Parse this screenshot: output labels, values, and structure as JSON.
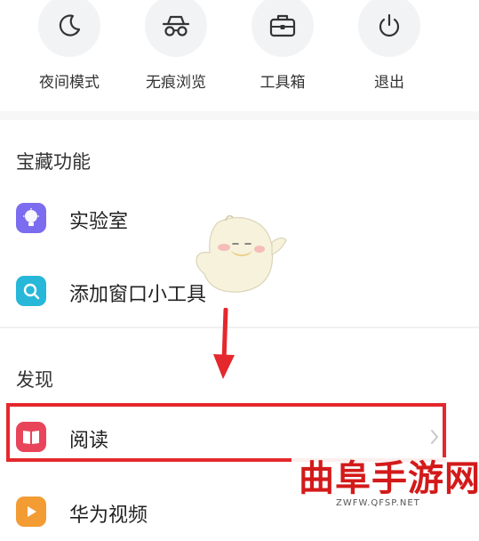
{
  "quick_actions": [
    {
      "label": "夜间模式",
      "icon": "moon-icon"
    },
    {
      "label": "无痕浏览",
      "icon": "incognito-icon"
    },
    {
      "label": "工具箱",
      "icon": "toolbox-icon"
    },
    {
      "label": "退出",
      "icon": "power-icon"
    }
  ],
  "treasure": {
    "title": "宝藏功能",
    "items": [
      {
        "label": "实验室",
        "icon": "lightbulb-icon",
        "color": "#7b6cf0"
      },
      {
        "label": "添加窗口小工具",
        "icon": "search-widget-icon",
        "color": "#27b7d8"
      }
    ]
  },
  "discover": {
    "title": "发现",
    "items": [
      {
        "label": "阅读",
        "icon": "book-icon",
        "color": "#e8455a"
      },
      {
        "label": "华为视频",
        "icon": "video-icon",
        "color": "#f39c34"
      }
    ]
  },
  "watermark": {
    "title": "曲阜手游网",
    "url": "ZWFW.QFSP.NET"
  },
  "colors": {
    "highlight": "#e4282d",
    "icon_bg": "#f2f3f5"
  }
}
